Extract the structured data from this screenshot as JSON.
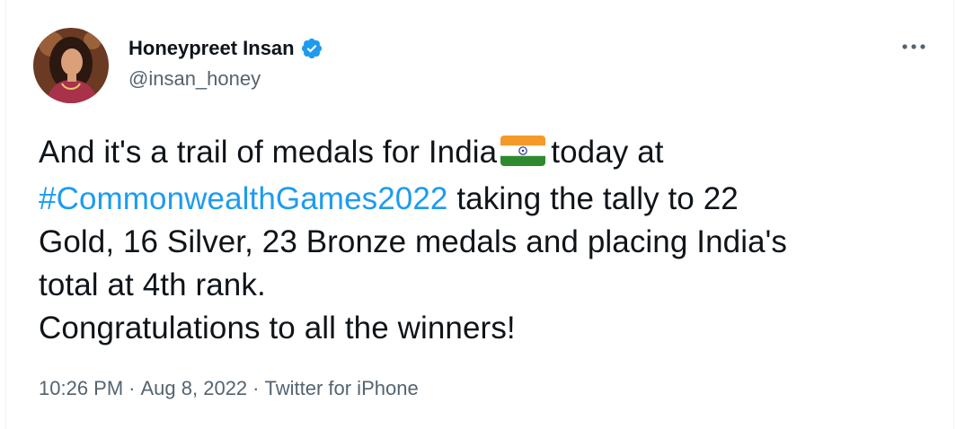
{
  "author": {
    "display_name": "Honeypreet Insan",
    "handle": "@insan_honey",
    "verified": true,
    "avatar_icon": "profile-photo"
  },
  "tweet": {
    "line1_before_flag": "And it's a trail of medals for India",
    "flag_icon": "india-flag-emoji",
    "line1_after_flag": "today at",
    "hashtag": "#CommonwealthGames2022",
    "line2_after_hashtag": " taking the tally to 22",
    "line3": "Gold, 16 Silver, 23 Bronze medals and placing India's",
    "line4": "total at 4th rank.",
    "line5": "Congratulations to all the winners!"
  },
  "meta": {
    "time": "10:26 PM",
    "separator": "·",
    "date": "Aug 8, 2022",
    "source": "Twitter for iPhone"
  },
  "colors": {
    "link": "#1d9bf0",
    "secondary_text": "#536471",
    "primary_text": "#0f1419",
    "verified_badge": "#1d9bf0"
  }
}
